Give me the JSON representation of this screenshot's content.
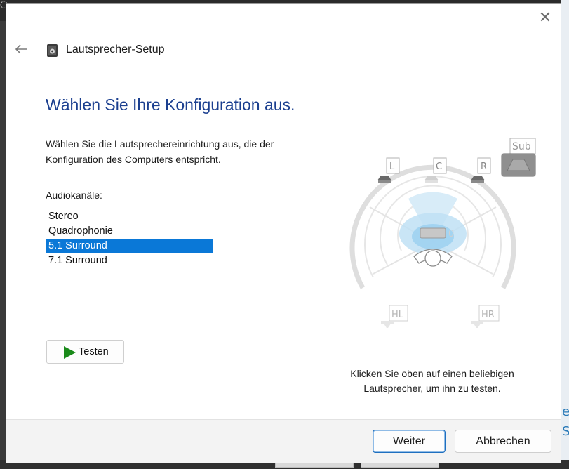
{
  "window": {
    "title": "Lautsprecher-Setup",
    "close_glyph": "✕",
    "icons": {
      "back": "back-arrow-icon",
      "title": "speaker-icon",
      "close": "close-icon"
    }
  },
  "main": {
    "heading": "Wählen Sie Ihre Konfiguration aus.",
    "description": "Wählen Sie die Lautsprechereinrichtung aus, die der Konfiguration des Computers entspricht.",
    "channels_label": "Audiokanäle:",
    "channels": [
      {
        "label": "Stereo",
        "selected": false
      },
      {
        "label": "Quadrophonie",
        "selected": false
      },
      {
        "label": "5.1 Surround",
        "selected": true
      },
      {
        "label": "7.1 Surround",
        "selected": false
      }
    ],
    "test_button": "Testen",
    "hint": "Klicken Sie oben auf einen beliebigen Lautsprecher, um ihn zu testen."
  },
  "diagram": {
    "speakers": {
      "left": "L",
      "center": "C",
      "right": "R",
      "sub": "Sub",
      "rear_left": "HL",
      "rear_right": "HR"
    },
    "accent": "#7fc4ee"
  },
  "footer": {
    "next": "Weiter",
    "cancel": "Abbrechen"
  },
  "colors": {
    "heading": "#1b3f8f",
    "selection": "#0a78d7",
    "play": "#1a8a1a"
  }
}
